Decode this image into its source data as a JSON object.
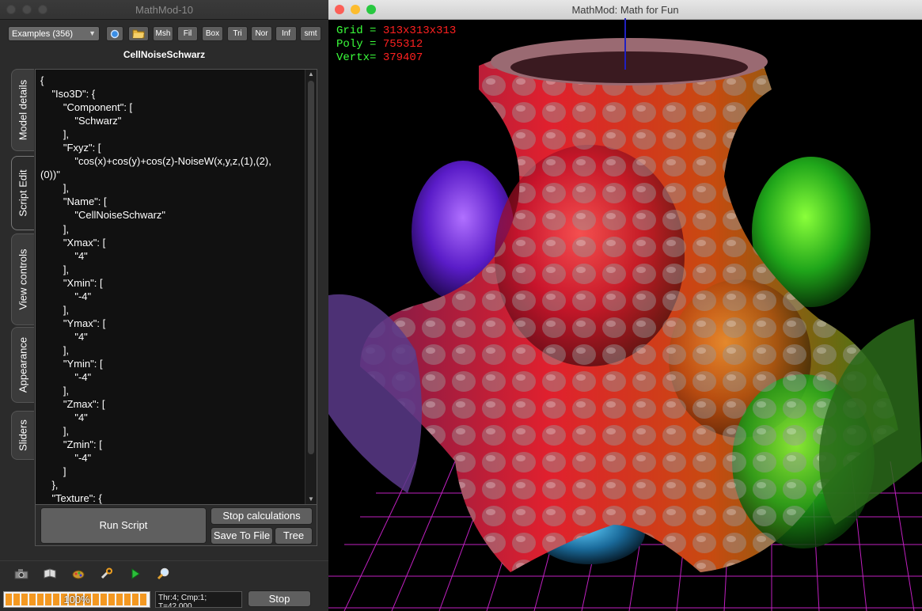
{
  "left_window": {
    "title": "MathMod-10",
    "examples_combo": "Examples (356)",
    "toolbar_buttons": [
      "Msh",
      "Fil",
      "Box",
      "Tri",
      "Nor",
      "Inf",
      "smt"
    ],
    "model_name": "CellNoiseSchwarz",
    "side_tabs": [
      "Model details",
      "Script Edit",
      "View controls",
      "Appearance",
      "Sliders"
    ],
    "active_tab": "Script Edit",
    "script": "{\n    \"Iso3D\": {\n        \"Component\": [\n            \"Schwarz\"\n        ],\n        \"Fxyz\": [\n            \"cos(x)+cos(y)+cos(z)-NoiseW(x,y,z,(1),(2),\n(0))\"\n        ],\n        \"Name\": [\n            \"CellNoiseSchwarz\"\n        ],\n        \"Xmax\": [\n            \"4\"\n        ],\n        \"Xmin\": [\n            \"-4\"\n        ],\n        \"Ymax\": [\n            \"4\"\n        ],\n        \"Ymin\": [\n            \"-4\"\n        ],\n        \"Zmax\": [\n            \"4\"\n        ],\n        \"Zmin\": [\n            \"-4\"\n        ]\n    },\n    \"Texture\": {",
    "buttons": {
      "run_script": "Run Script",
      "stop_calculations": "Stop calculations",
      "save_to_file": "Save To File",
      "tree": "Tree"
    },
    "bottom_icons": [
      "camera-icon",
      "book-icon",
      "color-icon",
      "wrench-icon",
      "play-icon",
      "search-icon"
    ],
    "progress": {
      "label": "100%",
      "value": 100
    },
    "status_text": "Thr:4; Cmp:1;\nT=42,000",
    "stop_button": "Stop"
  },
  "right_window": {
    "title": "MathMod: Math for Fun",
    "stats": [
      {
        "label": "Grid",
        "value": "313x313x313"
      },
      {
        "label": "Poly",
        "value": "755312"
      },
      {
        "label": "Vertx",
        "value": "379407"
      }
    ]
  },
  "colors": {
    "label_green": "#3bff3b",
    "value_red": "#ff2020",
    "grid_magenta": "#c020c0",
    "progress_orange": "#f39821"
  }
}
